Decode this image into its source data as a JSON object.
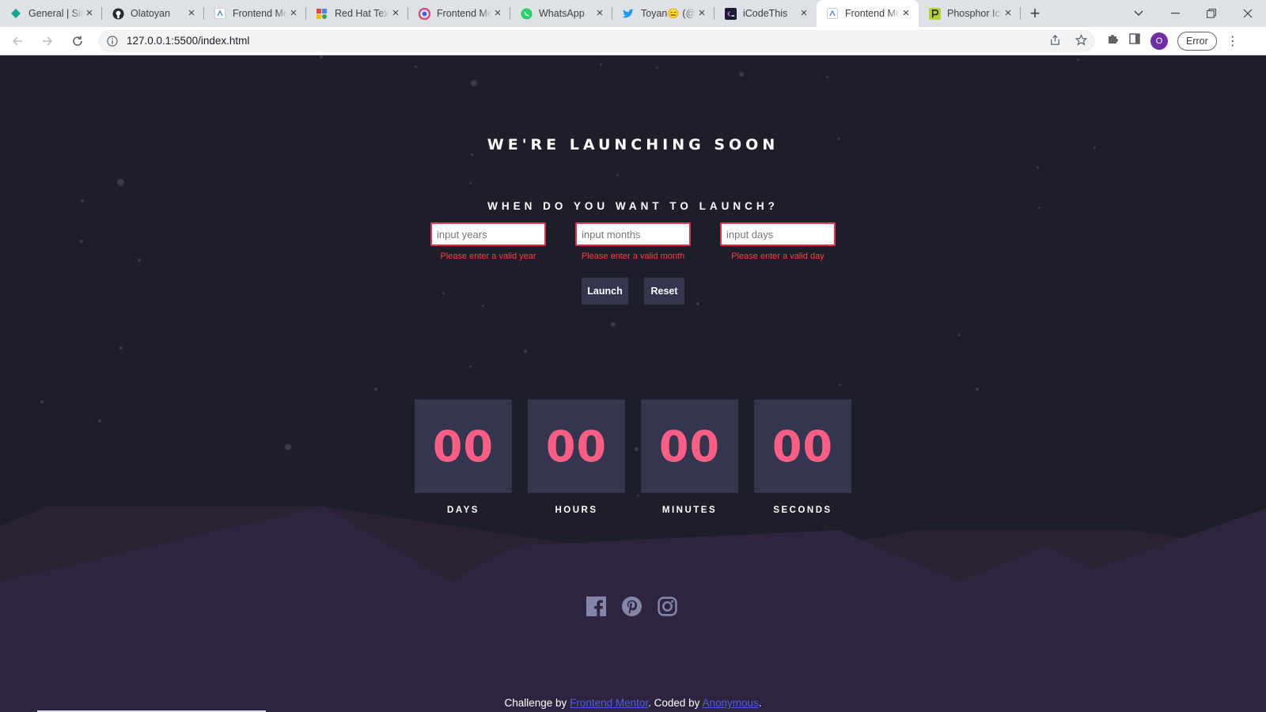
{
  "browser": {
    "tabs": [
      {
        "title": "General | Site",
        "icon": "diamond-icon",
        "color": "#15a394"
      },
      {
        "title": "Olatoyan",
        "icon": "github-icon",
        "color": "#24292f"
      },
      {
        "title": "Frontend Me",
        "icon": "frontend-mentor-icon",
        "color": "#5e8fd5"
      },
      {
        "title": "Red Hat Text",
        "icon": "google-fonts-icon",
        "color": "#ea4335"
      },
      {
        "title": "Frontend Me",
        "icon": "frontend-mentor-icon",
        "color": "#8e44ad"
      },
      {
        "title": "WhatsApp",
        "icon": "whatsapp-icon",
        "color": "#25d366"
      },
      {
        "title": "Toyan😑 (@",
        "icon": "twitter-icon",
        "color": "#1d9bf0"
      },
      {
        "title": "iCodeThis",
        "icon": "icodethis-icon",
        "color": "#3b2a5c"
      },
      {
        "title": "Frontend Me",
        "icon": "frontend-mentor-icon",
        "color": "#5e8fd5",
        "active": true
      },
      {
        "title": "Phosphor Ico",
        "icon": "phosphor-icon",
        "color": "#b6d136"
      }
    ],
    "url": "127.0.0.1:5500/index.html",
    "profile_initial": "O",
    "status_pill": "Error"
  },
  "page": {
    "headline": "WE'RE LAUNCHING SOON",
    "question": "WHEN DO YOU WANT TO LAUNCH?",
    "inputs": [
      {
        "placeholder": "input years",
        "error": "Please enter a valid year"
      },
      {
        "placeholder": "input months",
        "error": "Please enter a valid month"
      },
      {
        "placeholder": "input days",
        "error": "Please enter a valid day"
      }
    ],
    "buttons": {
      "launch": "Launch",
      "reset": "Reset"
    },
    "countdown": [
      {
        "value": "00",
        "label": "DAYS"
      },
      {
        "value": "00",
        "label": "HOURS"
      },
      {
        "value": "00",
        "label": "MINUTES"
      },
      {
        "value": "00",
        "label": "SECONDS"
      }
    ],
    "socials": [
      "facebook-icon",
      "pinterest-icon",
      "instagram-icon"
    ],
    "attribution": {
      "prefix": "Challenge by ",
      "link1": "Frontend Mentor",
      "middle": ". Coded by ",
      "link2": "Anonymous",
      "suffix": "."
    }
  },
  "colors": {
    "background": "#1e1e2a",
    "card": "#343650",
    "number": "#fb5e84",
    "error": "#ff3c3c",
    "hills_dark": "#2a2232",
    "hills_light": "#2f2440",
    "social_icon": "#8385a9"
  }
}
